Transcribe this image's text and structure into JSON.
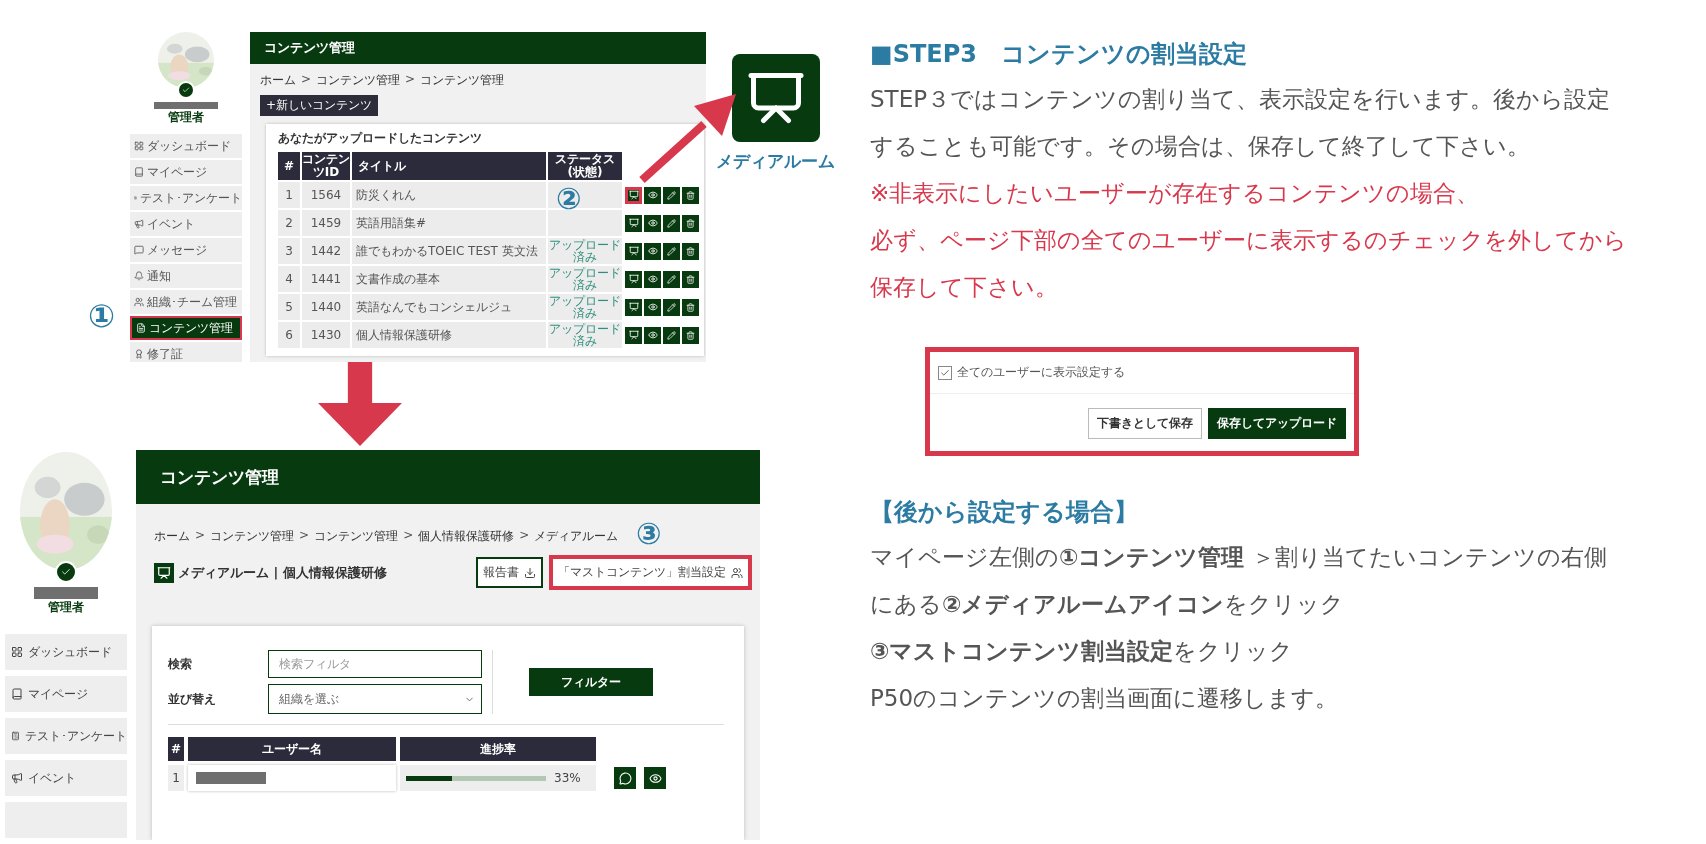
{
  "top_screenshot": {
    "sidebar": {
      "role": "管理者",
      "items": [
        {
          "label": "ダッシュボード",
          "selected": false
        },
        {
          "label": "マイページ",
          "selected": false
        },
        {
          "label": "テスト･アンケート",
          "selected": false
        },
        {
          "label": "イベント",
          "selected": false
        },
        {
          "label": "メッセージ",
          "selected": false
        },
        {
          "label": "通知",
          "selected": false
        },
        {
          "label": "組織･チーム管理",
          "selected": false
        },
        {
          "label": "コンテンツ管理",
          "selected": true
        },
        {
          "label": "修了証",
          "selected": false
        }
      ]
    },
    "header": "コンテンツ管理",
    "breadcrumb": {
      "separator": ">",
      "items": [
        "ホーム",
        "コンテンツ管理",
        "コンテンツ管理"
      ]
    },
    "new_button": "+新しいコンテンツ",
    "card_title": "あなたがアップロードしたコンテンツ",
    "columns": [
      "#",
      "コンテンツID",
      "タイトル",
      "ステータス(状態)"
    ],
    "rows": [
      {
        "no": "1",
        "id": "1564",
        "title": "防災くれん",
        "media_highlighted": true
      },
      {
        "no": "2",
        "id": "1459",
        "title": "英語用語集#",
        "media_highlighted": false
      },
      {
        "no": "3",
        "id": "1442",
        "title": "誰でもわかるTOEIC TEST 英文法",
        "status": "アップロード済み",
        "media_highlighted": false
      },
      {
        "no": "4",
        "id": "1441",
        "title": "文書作成の基本",
        "status": "アップロード済み",
        "media_highlighted": false
      },
      {
        "no": "5",
        "id": "1440",
        "title": "英語なんでもコンシェルジュ",
        "status": "アップロード済み",
        "media_highlighted": false
      },
      {
        "no": "6",
        "id": "1430",
        "title": "個人情報保護研修",
        "status": "アップロード済み",
        "media_highlighted": false
      }
    ],
    "markers": [
      "①",
      "②"
    ]
  },
  "media_icon": {
    "label": "メディアルーム"
  },
  "bottom_screenshot": {
    "sidebar": {
      "role": "管理者",
      "items": [
        {
          "label": "ダッシュボード"
        },
        {
          "label": "マイページ"
        },
        {
          "label": "テスト･アンケート"
        },
        {
          "label": "イベント"
        }
      ]
    },
    "header": "コンテンツ管理",
    "breadcrumb": {
      "separator": ">",
      "items": [
        "ホーム",
        "コンテンツ管理",
        "コンテンツ管理",
        "個人情報保護研修",
        "メディアルーム"
      ]
    },
    "page_title": "メディアルーム | 個人情報保護研修",
    "report_button": "報告書",
    "assign_button": {
      "label": "「マストコンテンツ」割当設定",
      "highlighted": true
    },
    "marker": "③",
    "search": {
      "label": "検索",
      "placeholder": "検索フィルタ"
    },
    "sort": {
      "label": "並び替え",
      "value": "組織を選ぶ"
    },
    "filter_button": "フィルター",
    "columns": [
      "#",
      "ユーザー名",
      "進捗率"
    ],
    "rows": [
      {
        "no": "1",
        "level": 0.33,
        "reading": "33%"
      }
    ]
  },
  "step": {
    "heading": "■STEP3　コンテンツの割当設定",
    "text": "STEP３ではコンテンツの割り当て、表示設定を行います。後から設定することも可能です。その場合は、保存して終了して下さい。",
    "warning": [
      "※非表示にしたいユーザーが存在するコンテンツの場合、",
      "必ず、ページ下部の全てのユーザーに表示するのチェックを外してから",
      "保存して下さい。"
    ]
  },
  "save_example": {
    "checkbox": {
      "label": "全てのユーザーに表示設定する",
      "checked": true
    },
    "buttons": [
      "下書きとして保存",
      "保存してアップロード"
    ]
  },
  "later": {
    "heading": "【後から設定する場合】",
    "lines": [
      "マイページ左側の**①コンテンツ管理** ＞割り当てたいコンテンツの右側にある**②メディアルームアイコン**をクリック",
      "**③マストコンテンツ割当設定**をクリック",
      "P50のコンテンツの割当画面に遷移します。"
    ]
  }
}
